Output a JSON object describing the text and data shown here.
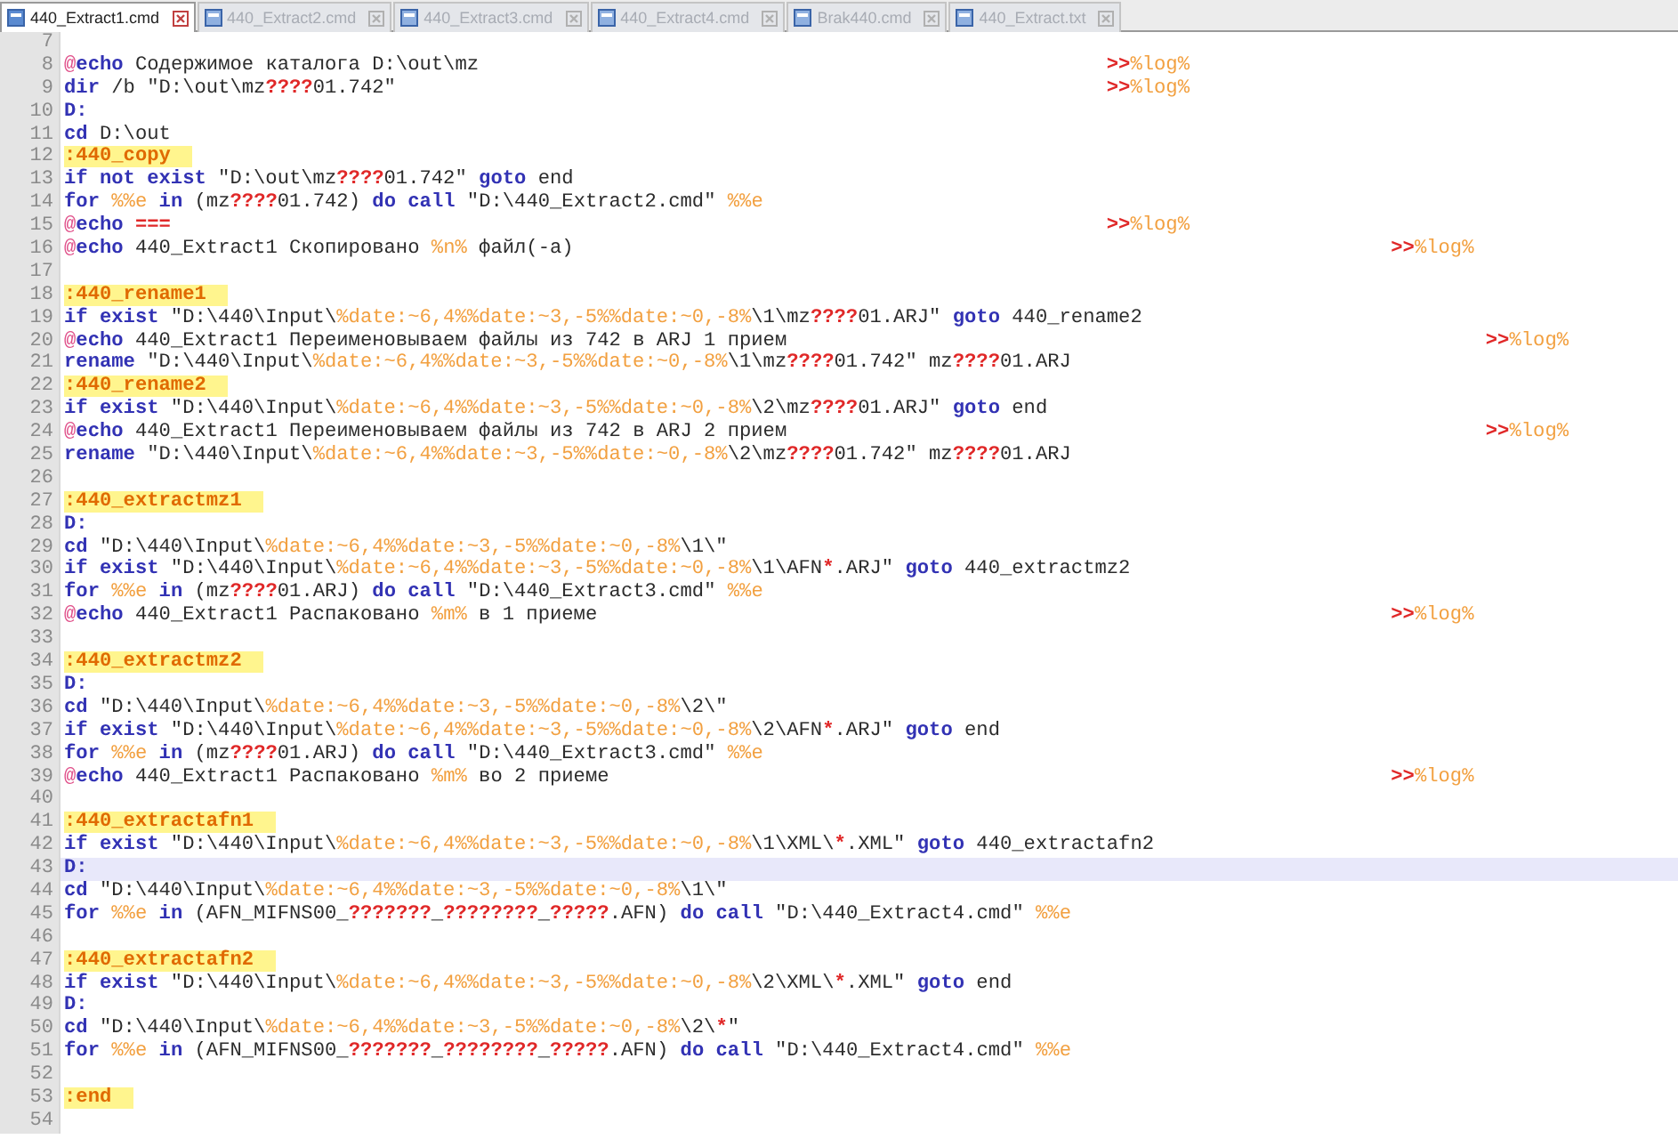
{
  "tabs": [
    {
      "label": "440_Extract1.cmd",
      "selected": true
    },
    {
      "label": "440_Extract2.cmd",
      "selected": false
    },
    {
      "label": "440_Extract3.cmd",
      "selected": false
    },
    {
      "label": "440_Extract4.cmd",
      "selected": false
    },
    {
      "label": "Brak440.cmd",
      "selected": false
    },
    {
      "label": "440_Extract.txt",
      "selected": false
    }
  ],
  "lines": [
    {
      "number": "7",
      "current": false
    },
    {
      "number": "8",
      "current": false,
      "segments": [
        {
          "kind": "at",
          "text": "@"
        },
        {
          "kind": "keyword",
          "text": "echo "
        },
        {
          "kind": "plain",
          "text": "Содержимое каталога D:\\out\\mz\t\t\t\t\t\t\t"
        },
        {
          "kind": "symbol",
          "text": ">>"
        },
        {
          "kind": "variable",
          "text": "%log%"
        }
      ]
    },
    {
      "number": "9",
      "current": false,
      "segments": [
        {
          "kind": "keyword",
          "text": "dir "
        },
        {
          "kind": "plain",
          "text": "/b \"D:\\out\\mz"
        },
        {
          "kind": "symbol",
          "text": "????"
        },
        {
          "kind": "plain",
          "text": "01.742\"\t\t\t\t\t\t\t\t"
        },
        {
          "kind": "symbol",
          "text": ">>"
        },
        {
          "kind": "variable",
          "text": "%log%"
        }
      ]
    },
    {
      "number": "10",
      "current": false,
      "segments": [
        {
          "kind": "keyword",
          "text": "D:"
        }
      ]
    },
    {
      "number": "11",
      "current": false,
      "segments": [
        {
          "kind": "keyword",
          "text": "cd "
        },
        {
          "kind": "plain",
          "text": "D:\\out"
        }
      ]
    },
    {
      "number": "12",
      "current": false,
      "segments": [
        {
          "kind": "label",
          "text": ":440_copy"
        }
      ]
    },
    {
      "number": "13",
      "current": false,
      "segments": [
        {
          "kind": "keyword",
          "text": "if not exist "
        },
        {
          "kind": "plain",
          "text": "\"D:\\out\\mz"
        },
        {
          "kind": "symbol",
          "text": "????"
        },
        {
          "kind": "plain",
          "text": "01.742\" "
        },
        {
          "kind": "keyword",
          "text": "goto "
        },
        {
          "kind": "plain",
          "text": "end"
        }
      ]
    },
    {
      "number": "14",
      "current": false,
      "segments": [
        {
          "kind": "keyword",
          "text": "for "
        },
        {
          "kind": "variable",
          "text": "%%e "
        },
        {
          "kind": "keyword",
          "text": "in "
        },
        {
          "kind": "plain",
          "text": "(mz"
        },
        {
          "kind": "symbol",
          "text": "????"
        },
        {
          "kind": "plain",
          "text": "01.742) "
        },
        {
          "kind": "keyword",
          "text": "do call "
        },
        {
          "kind": "plain",
          "text": "\"D:\\440_Extract2.cmd\" "
        },
        {
          "kind": "variable",
          "text": "%%e"
        }
      ]
    },
    {
      "number": "15",
      "current": false,
      "segments": [
        {
          "kind": "at",
          "text": "@"
        },
        {
          "kind": "keyword",
          "text": "echo "
        },
        {
          "kind": "symbol",
          "text": "===\t\t\t\t\t\t\t\t\t\t"
        },
        {
          "kind": "symbol",
          "text": ">>"
        },
        {
          "kind": "variable",
          "text": "%log%"
        }
      ]
    },
    {
      "number": "16",
      "current": false,
      "segments": [
        {
          "kind": "at",
          "text": "@"
        },
        {
          "kind": "keyword",
          "text": "echo "
        },
        {
          "kind": "plain",
          "text": "440_Extract1 Скопировано "
        },
        {
          "kind": "variable",
          "text": "%n% "
        },
        {
          "kind": "plain",
          "text": "файл(-а)\t\t\t\t\t\t\t\t\t"
        },
        {
          "kind": "symbol",
          "text": ">>"
        },
        {
          "kind": "variable",
          "text": "%log%"
        }
      ]
    },
    {
      "number": "17",
      "current": false
    },
    {
      "number": "18",
      "current": false,
      "segments": [
        {
          "kind": "label",
          "text": ":440_rename1"
        }
      ]
    },
    {
      "number": "19",
      "current": false,
      "segments": [
        {
          "kind": "keyword",
          "text": "if exist "
        },
        {
          "kind": "plain",
          "text": "\"D:\\440\\Input\\"
        },
        {
          "kind": "variable",
          "text": "%date:~6,4%%date:~3,-5%%date:~0,-8%"
        },
        {
          "kind": "plain",
          "text": "\\1\\mz"
        },
        {
          "kind": "symbol",
          "text": "????"
        },
        {
          "kind": "plain",
          "text": "01.ARJ\" "
        },
        {
          "kind": "keyword",
          "text": "goto "
        },
        {
          "kind": "plain",
          "text": "440_rename2"
        }
      ]
    },
    {
      "number": "20",
      "current": false,
      "segments": [
        {
          "kind": "at",
          "text": "@"
        },
        {
          "kind": "keyword",
          "text": "echo "
        },
        {
          "kind": "plain",
          "text": "440_Extract1 Переименовываем файлы из 742 в ARJ 1 прием\t\t\t\t\t\t\t\t"
        },
        {
          "kind": "symbol",
          "text": ">>"
        },
        {
          "kind": "variable",
          "text": "%log%"
        }
      ]
    },
    {
      "number": "21",
      "current": false,
      "segments": [
        {
          "kind": "keyword",
          "text": "rename "
        },
        {
          "kind": "plain",
          "text": "\"D:\\440\\Input\\"
        },
        {
          "kind": "variable",
          "text": "%date:~6,4%%date:~3,-5%%date:~0,-8%"
        },
        {
          "kind": "plain",
          "text": "\\1\\mz"
        },
        {
          "kind": "symbol",
          "text": "????"
        },
        {
          "kind": "plain",
          "text": "01.742\" mz"
        },
        {
          "kind": "symbol",
          "text": "????"
        },
        {
          "kind": "plain",
          "text": "01.ARJ"
        }
      ]
    },
    {
      "number": "22",
      "current": false,
      "segments": [
        {
          "kind": "label",
          "text": ":440_rename2"
        }
      ]
    },
    {
      "number": "23",
      "current": false,
      "segments": [
        {
          "kind": "keyword",
          "text": "if exist "
        },
        {
          "kind": "plain",
          "text": "\"D:\\440\\Input\\"
        },
        {
          "kind": "variable",
          "text": "%date:~6,4%%date:~3,-5%%date:~0,-8%"
        },
        {
          "kind": "plain",
          "text": "\\2\\mz"
        },
        {
          "kind": "symbol",
          "text": "????"
        },
        {
          "kind": "plain",
          "text": "01.ARJ\" "
        },
        {
          "kind": "keyword",
          "text": "goto "
        },
        {
          "kind": "plain",
          "text": "end"
        }
      ]
    },
    {
      "number": "24",
      "current": false,
      "segments": [
        {
          "kind": "at",
          "text": "@"
        },
        {
          "kind": "keyword",
          "text": "echo "
        },
        {
          "kind": "plain",
          "text": "440_Extract1 Переименовываем файлы из 742 в ARJ 2 прием\t\t\t\t\t\t\t\t"
        },
        {
          "kind": "symbol",
          "text": ">>"
        },
        {
          "kind": "variable",
          "text": "%log%"
        }
      ]
    },
    {
      "number": "25",
      "current": false,
      "segments": [
        {
          "kind": "keyword",
          "text": "rename "
        },
        {
          "kind": "plain",
          "text": "\"D:\\440\\Input\\"
        },
        {
          "kind": "variable",
          "text": "%date:~6,4%%date:~3,-5%%date:~0,-8%"
        },
        {
          "kind": "plain",
          "text": "\\2\\mz"
        },
        {
          "kind": "symbol",
          "text": "????"
        },
        {
          "kind": "plain",
          "text": "01.742\" mz"
        },
        {
          "kind": "symbol",
          "text": "????"
        },
        {
          "kind": "plain",
          "text": "01.ARJ"
        }
      ]
    },
    {
      "number": "26",
      "current": false
    },
    {
      "number": "27",
      "current": false,
      "segments": [
        {
          "kind": "label",
          "text": ":440_extractmz1"
        }
      ]
    },
    {
      "number": "28",
      "current": false,
      "segments": [
        {
          "kind": "keyword",
          "text": "D:"
        }
      ]
    },
    {
      "number": "29",
      "current": false,
      "segments": [
        {
          "kind": "keyword",
          "text": "cd "
        },
        {
          "kind": "plain",
          "text": "\"D:\\440\\Input\\"
        },
        {
          "kind": "variable",
          "text": "%date:~6,4%%date:~3,-5%%date:~0,-8%"
        },
        {
          "kind": "plain",
          "text": "\\1\\\""
        }
      ]
    },
    {
      "number": "30",
      "current": false,
      "segments": [
        {
          "kind": "keyword",
          "text": "if exist "
        },
        {
          "kind": "plain",
          "text": "\"D:\\440\\Input\\"
        },
        {
          "kind": "variable",
          "text": "%date:~6,4%%date:~3,-5%%date:~0,-8%"
        },
        {
          "kind": "plain",
          "text": "\\1\\AFN"
        },
        {
          "kind": "symbol",
          "text": "*"
        },
        {
          "kind": "plain",
          "text": ".ARJ\" "
        },
        {
          "kind": "keyword",
          "text": "goto "
        },
        {
          "kind": "plain",
          "text": "440_extractmz2"
        }
      ]
    },
    {
      "number": "31",
      "current": false,
      "segments": [
        {
          "kind": "keyword",
          "text": "for "
        },
        {
          "kind": "variable",
          "text": "%%e "
        },
        {
          "kind": "keyword",
          "text": "in "
        },
        {
          "kind": "plain",
          "text": "(mz"
        },
        {
          "kind": "symbol",
          "text": "????"
        },
        {
          "kind": "plain",
          "text": "01.ARJ) "
        },
        {
          "kind": "keyword",
          "text": "do call "
        },
        {
          "kind": "plain",
          "text": "\"D:\\440_Extract3.cmd\" "
        },
        {
          "kind": "variable",
          "text": "%%e"
        }
      ]
    },
    {
      "number": "32",
      "current": false,
      "segments": [
        {
          "kind": "at",
          "text": "@"
        },
        {
          "kind": "keyword",
          "text": "echo "
        },
        {
          "kind": "plain",
          "text": "440_Extract1 Распаковано "
        },
        {
          "kind": "variable",
          "text": "%m% "
        },
        {
          "kind": "plain",
          "text": "в 1 приеме\t\t\t\t\t\t\t\t\t"
        },
        {
          "kind": "symbol",
          "text": ">>"
        },
        {
          "kind": "variable",
          "text": "%log%"
        }
      ]
    },
    {
      "number": "33",
      "current": false
    },
    {
      "number": "34",
      "current": false,
      "segments": [
        {
          "kind": "label",
          "text": ":440_extractmz2"
        }
      ]
    },
    {
      "number": "35",
      "current": false,
      "segments": [
        {
          "kind": "keyword",
          "text": "D:"
        }
      ]
    },
    {
      "number": "36",
      "current": false,
      "segments": [
        {
          "kind": "keyword",
          "text": "cd "
        },
        {
          "kind": "plain",
          "text": "\"D:\\440\\Input\\"
        },
        {
          "kind": "variable",
          "text": "%date:~6,4%%date:~3,-5%%date:~0,-8%"
        },
        {
          "kind": "plain",
          "text": "\\2\\\""
        }
      ]
    },
    {
      "number": "37",
      "current": false,
      "segments": [
        {
          "kind": "keyword",
          "text": "if exist "
        },
        {
          "kind": "plain",
          "text": "\"D:\\440\\Input\\"
        },
        {
          "kind": "variable",
          "text": "%date:~6,4%%date:~3,-5%%date:~0,-8%"
        },
        {
          "kind": "plain",
          "text": "\\2\\AFN"
        },
        {
          "kind": "symbol",
          "text": "*"
        },
        {
          "kind": "plain",
          "text": ".ARJ\" "
        },
        {
          "kind": "keyword",
          "text": "goto "
        },
        {
          "kind": "plain",
          "text": "end"
        }
      ]
    },
    {
      "number": "38",
      "current": false,
      "segments": [
        {
          "kind": "keyword",
          "text": "for "
        },
        {
          "kind": "variable",
          "text": "%%e "
        },
        {
          "kind": "keyword",
          "text": "in "
        },
        {
          "kind": "plain",
          "text": "(mz"
        },
        {
          "kind": "symbol",
          "text": "????"
        },
        {
          "kind": "plain",
          "text": "01.ARJ) "
        },
        {
          "kind": "keyword",
          "text": "do call "
        },
        {
          "kind": "plain",
          "text": "\"D:\\440_Extract3.cmd\" "
        },
        {
          "kind": "variable",
          "text": "%%e"
        }
      ]
    },
    {
      "number": "39",
      "current": false,
      "segments": [
        {
          "kind": "at",
          "text": "@"
        },
        {
          "kind": "keyword",
          "text": "echo "
        },
        {
          "kind": "plain",
          "text": "440_Extract1 Распаковано "
        },
        {
          "kind": "variable",
          "text": "%m% "
        },
        {
          "kind": "plain",
          "text": "во 2 приеме\t\t\t\t\t\t\t\t\t"
        },
        {
          "kind": "symbol",
          "text": ">>"
        },
        {
          "kind": "variable",
          "text": "%log%"
        }
      ]
    },
    {
      "number": "40",
      "current": false
    },
    {
      "number": "41",
      "current": false,
      "segments": [
        {
          "kind": "label",
          "text": ":440_extractafn1"
        }
      ]
    },
    {
      "number": "42",
      "current": false,
      "segments": [
        {
          "kind": "keyword",
          "text": "if exist "
        },
        {
          "kind": "plain",
          "text": "\"D:\\440\\Input\\"
        },
        {
          "kind": "variable",
          "text": "%date:~6,4%%date:~3,-5%%date:~0,-8%"
        },
        {
          "kind": "plain",
          "text": "\\1\\XML\\"
        },
        {
          "kind": "symbol",
          "text": "*"
        },
        {
          "kind": "plain",
          "text": ".XML\" "
        },
        {
          "kind": "keyword",
          "text": "goto "
        },
        {
          "kind": "plain",
          "text": "440_extractafn2"
        }
      ]
    },
    {
      "number": "43",
      "current": true,
      "segments": [
        {
          "kind": "keyword",
          "text": "D:"
        }
      ]
    },
    {
      "number": "44",
      "current": false,
      "segments": [
        {
          "kind": "keyword",
          "text": "cd "
        },
        {
          "kind": "plain",
          "text": "\"D:\\440\\Input\\"
        },
        {
          "kind": "variable",
          "text": "%date:~6,4%%date:~3,-5%%date:~0,-8%"
        },
        {
          "kind": "plain",
          "text": "\\1\\\""
        }
      ]
    },
    {
      "number": "45",
      "current": false,
      "segments": [
        {
          "kind": "keyword",
          "text": "for "
        },
        {
          "kind": "variable",
          "text": "%%e "
        },
        {
          "kind": "keyword",
          "text": "in "
        },
        {
          "kind": "plain",
          "text": "(AFN_MIFNS00_"
        },
        {
          "kind": "symbol",
          "text": "???????"
        },
        {
          "kind": "plain",
          "text": "_"
        },
        {
          "kind": "symbol",
          "text": "????????"
        },
        {
          "kind": "plain",
          "text": "_"
        },
        {
          "kind": "symbol",
          "text": "?????"
        },
        {
          "kind": "plain",
          "text": ".AFN) "
        },
        {
          "kind": "keyword",
          "text": "do call "
        },
        {
          "kind": "plain",
          "text": "\"D:\\440_Extract4.cmd\" "
        },
        {
          "kind": "variable",
          "text": "%%e"
        }
      ]
    },
    {
      "number": "46",
      "current": false
    },
    {
      "number": "47",
      "current": false,
      "segments": [
        {
          "kind": "label",
          "text": ":440_extractafn2"
        }
      ]
    },
    {
      "number": "48",
      "current": false,
      "segments": [
        {
          "kind": "keyword",
          "text": "if exist "
        },
        {
          "kind": "plain",
          "text": "\"D:\\440\\Input\\"
        },
        {
          "kind": "variable",
          "text": "%date:~6,4%%date:~3,-5%%date:~0,-8%"
        },
        {
          "kind": "plain",
          "text": "\\2\\XML\\"
        },
        {
          "kind": "symbol",
          "text": "*"
        },
        {
          "kind": "plain",
          "text": ".XML\" "
        },
        {
          "kind": "keyword",
          "text": "goto "
        },
        {
          "kind": "plain",
          "text": "end"
        }
      ]
    },
    {
      "number": "49",
      "current": false,
      "segments": [
        {
          "kind": "keyword",
          "text": "D:"
        }
      ]
    },
    {
      "number": "50",
      "current": false,
      "segments": [
        {
          "kind": "keyword",
          "text": "cd "
        },
        {
          "kind": "plain",
          "text": "\"D:\\440\\Input\\"
        },
        {
          "kind": "variable",
          "text": "%date:~6,4%%date:~3,-5%%date:~0,-8%"
        },
        {
          "kind": "plain",
          "text": "\\2\\"
        },
        {
          "kind": "symbol",
          "text": "*"
        },
        {
          "kind": "plain",
          "text": "\""
        }
      ]
    },
    {
      "number": "51",
      "current": false,
      "segments": [
        {
          "kind": "keyword",
          "text": "for "
        },
        {
          "kind": "variable",
          "text": "%%e "
        },
        {
          "kind": "keyword",
          "text": "in "
        },
        {
          "kind": "plain",
          "text": "(AFN_MIFNS00_"
        },
        {
          "kind": "symbol",
          "text": "???????"
        },
        {
          "kind": "plain",
          "text": "_"
        },
        {
          "kind": "symbol",
          "text": "????????"
        },
        {
          "kind": "plain",
          "text": "_"
        },
        {
          "kind": "symbol",
          "text": "?????"
        },
        {
          "kind": "plain",
          "text": ".AFN) "
        },
        {
          "kind": "keyword",
          "text": "do call "
        },
        {
          "kind": "plain",
          "text": "\"D:\\440_Extract4.cmd\" "
        },
        {
          "kind": "variable",
          "text": "%%e"
        }
      ]
    },
    {
      "number": "52",
      "current": false
    },
    {
      "number": "53",
      "current": false,
      "segments": [
        {
          "kind": "label",
          "text": ":end"
        }
      ]
    },
    {
      "number": "54",
      "current": false
    }
  ]
}
